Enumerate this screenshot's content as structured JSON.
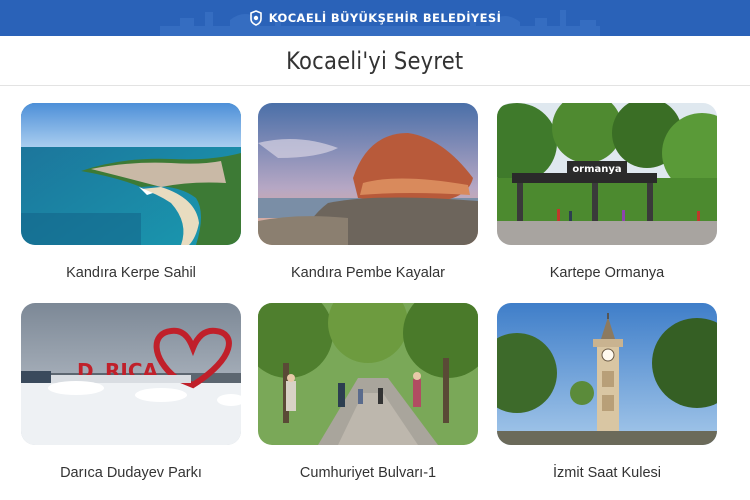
{
  "header": {
    "brand_title": "KOCAELİ BÜYÜKŞEHİR BELEDİYESİ",
    "background_color": "#2a62b8"
  },
  "page": {
    "title": "Kocaeli'yi Seyret"
  },
  "gallery": {
    "items": [
      {
        "label": "Kandıra Kerpe Sahil",
        "image": "coastline-aerial-image"
      },
      {
        "label": "Kandıra Pembe Kayalar",
        "image": "pink-rocks-image"
      },
      {
        "label": "Kartepe Ormanya",
        "image": "ormanya-entrance-image"
      },
      {
        "label": "Darıca Dudayev Parkı",
        "image": "darica-snow-park-image"
      },
      {
        "label": "Cumhuriyet Bulvarı-1",
        "image": "boulevard-trees-image"
      },
      {
        "label": "İzmit Saat Kulesi",
        "image": "clock-tower-image"
      }
    ],
    "sign_texts": {
      "ormanya": "ormanya",
      "darica_left": "D",
      "darica_right": "RICA"
    }
  }
}
